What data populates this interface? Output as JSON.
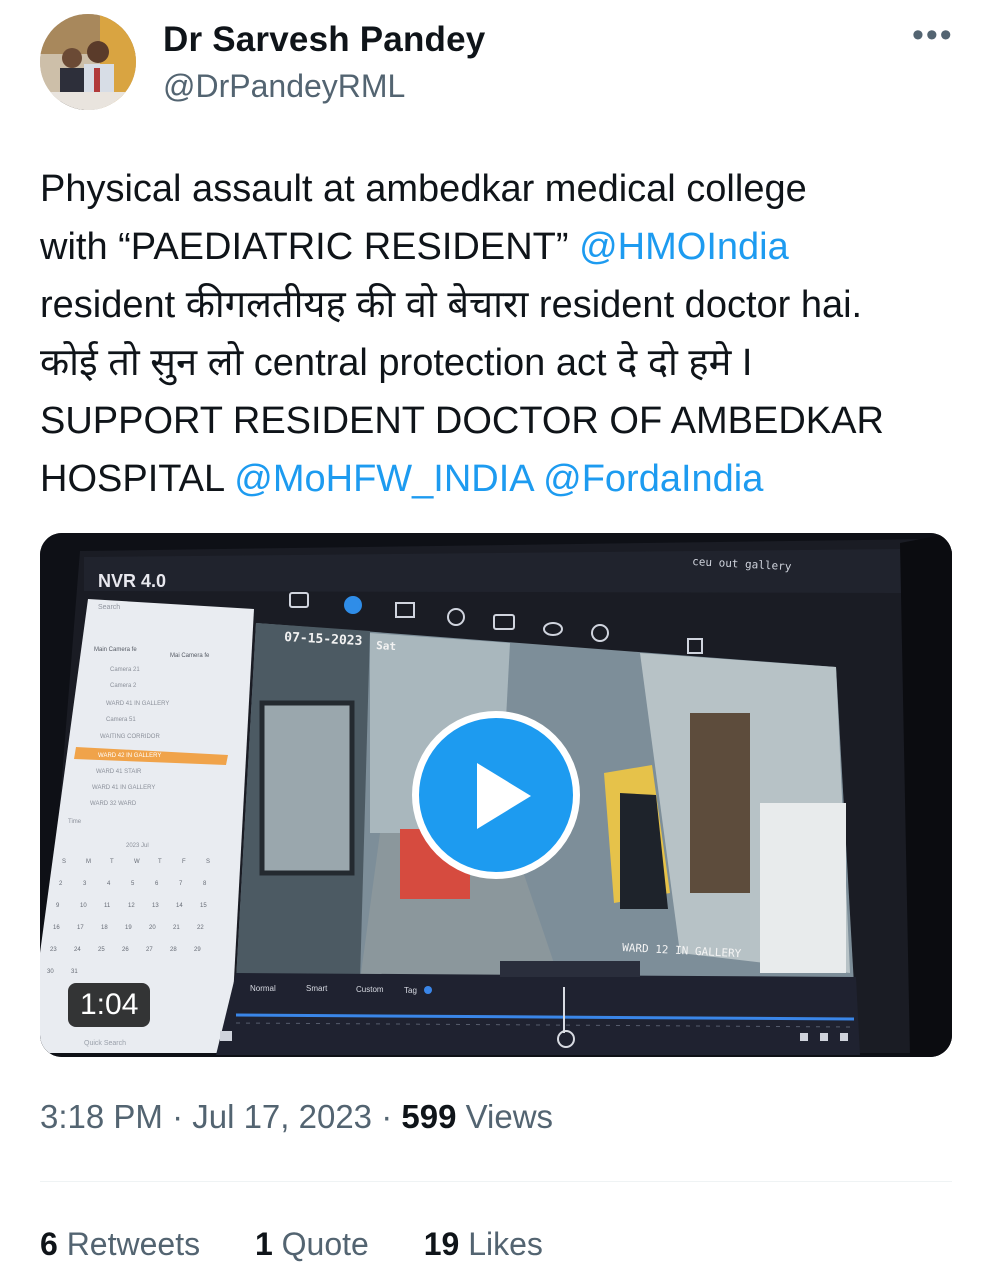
{
  "tweet": {
    "author": {
      "display_name": "Dr Sarvesh Pandey",
      "handle": "@DrPandeyRML"
    },
    "more_icon": "more-horizontal-icon",
    "text": {
      "line1": "Physical assault at ambedkar medical college",
      "line2_prefix": "with “PAEDIATRIC RESIDENT” ",
      "mention1": "@HMOIndia",
      "line3": "resident कीगलतीयह की वो बेचारा resident doctor hai.",
      "line4": "कोई तो सुन लो central protection act दे दो हमे I",
      "line5": "SUPPORT RESIDENT DOCTOR OF AMBEDKAR",
      "line6_prefix": "HOSPITAL ",
      "mention2": "@MoHFW_INDIA",
      "mention3": "@FordaIndia"
    },
    "video": {
      "duration": "1:04",
      "play_icon": "play-icon",
      "screen": {
        "app_title": "NVR 4.0",
        "overlay_date": "07-15-2023",
        "overlay_day": "Sat",
        "camera_label": "WARD 12 IN GALLERY",
        "top_right_label": "ceu out gallery",
        "timeline_tabs": [
          "Normal",
          "Smart",
          "Custom",
          "Tag"
        ],
        "sidebar_title": "Search",
        "sidebar_tabs": [
          "Main Camera fe",
          "Mai Camera fe"
        ],
        "sidebar_items": [
          "Camera 21",
          "Camera 2",
          "WARD 41 IN GALLERY",
          "Camera 51",
          "WAITING CORRIDOR",
          "WARD 42 IN GALLERY",
          "WARD 41 STAIR",
          "WARD 41 IN GALLERY",
          "WARD 32 WARD"
        ],
        "sidebar_selected": "WARD 42 IN GALLERY",
        "time_label": "Time",
        "calendar_month": "2023 Jul",
        "calendar_days": [
          "S",
          "M",
          "T",
          "W",
          "T",
          "F",
          "S"
        ],
        "calendar_rows": [
          [
            "2",
            "3",
            "4",
            "5",
            "6",
            "7",
            "8"
          ],
          [
            "9",
            "10",
            "11",
            "12",
            "13",
            "14",
            "15"
          ],
          [
            "16",
            "17",
            "18",
            "19",
            "20",
            "21",
            "22"
          ],
          [
            "23",
            "24",
            "25",
            "26",
            "27",
            "28",
            "29"
          ],
          [
            "30",
            "31"
          ]
        ],
        "bottom_left_label": "Quick Search"
      }
    },
    "timestamp": "3:18 PM · Jul 17, 2023 · ",
    "views_count": "599",
    "views_label": " Views",
    "stats": {
      "retweets_count": "6",
      "retweets_label": " Retweets",
      "quotes_count": "1",
      "quotes_label": " Quote",
      "likes_count": "19",
      "likes_label": " Likes"
    }
  }
}
